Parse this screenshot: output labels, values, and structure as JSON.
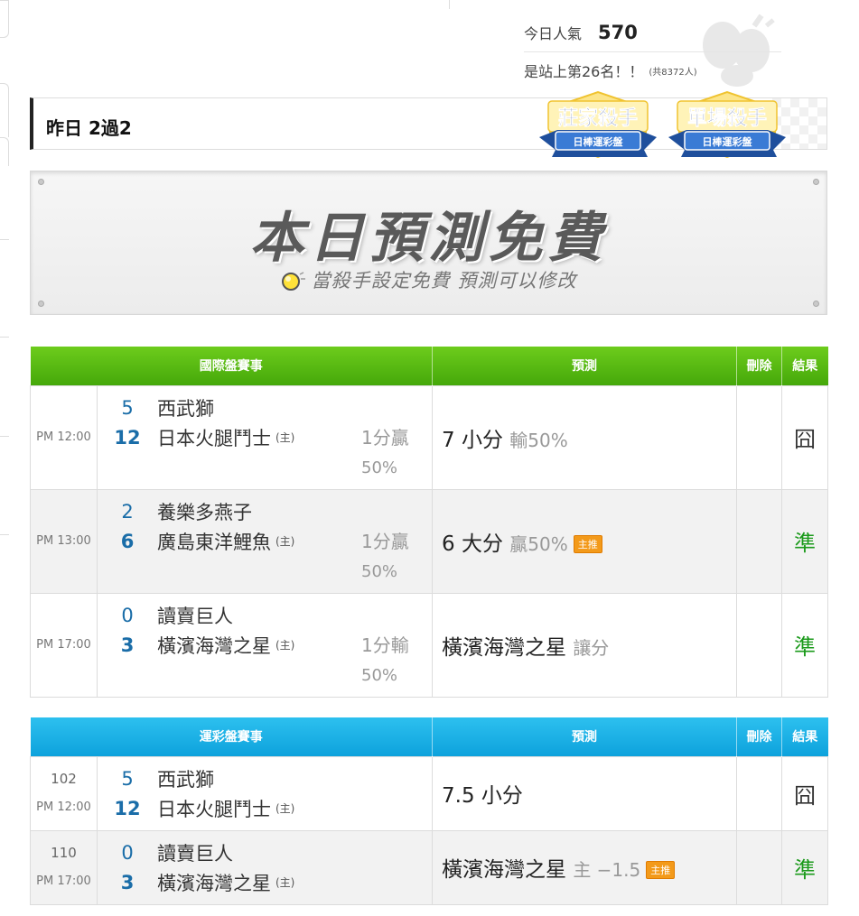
{
  "stats": {
    "today_label": "今日人氣",
    "today_value": "570",
    "rank_text": "是站上第26名！！",
    "rank_total": "(共8372人)"
  },
  "yesterday": {
    "text": "昨日 2過2"
  },
  "badges": [
    {
      "title": "莊家殺手",
      "sub": "日棒運彩盤"
    },
    {
      "title": "單場殺手",
      "sub": "日棒運彩盤"
    }
  ],
  "banner": {
    "title": "本日預測免費",
    "subtitle": "當殺手設定免費  預測可以修改"
  },
  "intl": {
    "headers": {
      "match": "國際盤賽事",
      "predict": "預測",
      "delete": "刪除",
      "result": "結果"
    },
    "rows": [
      {
        "time": "PM 12:00",
        "away_score": "5",
        "away": "西武獅",
        "home_score": "12",
        "home": "日本火腿鬥士",
        "host": "(主)",
        "spread": "1分贏",
        "pct": "50%",
        "pick": "7 小分",
        "pick_sub": "輸50%",
        "tag": "",
        "result": "囧"
      },
      {
        "time": "PM 13:00",
        "away_score": "2",
        "away": "養樂多燕子",
        "home_score": "6",
        "home": "廣島東洋鯉魚",
        "host": "(主)",
        "spread": "1分贏",
        "pct": "50%",
        "pick": "6 大分",
        "pick_sub": "贏50%",
        "tag": "主推",
        "result": "準"
      },
      {
        "time": "PM 17:00",
        "away_score": "0",
        "away": "讀賣巨人",
        "home_score": "3",
        "home": "橫濱海灣之星",
        "host": "(主)",
        "spread": "1分輸",
        "pct": "50%",
        "pick": "橫濱海灣之星",
        "pick_sub": "讓分",
        "tag": "",
        "result": "準"
      }
    ]
  },
  "lottery": {
    "headers": {
      "match": "運彩盤賽事",
      "predict": "預測",
      "delete": "刪除",
      "result": "結果"
    },
    "rows": [
      {
        "code": "102",
        "time": "PM 12:00",
        "away_score": "5",
        "away": "西武獅",
        "home_score": "12",
        "home": "日本火腿鬥士",
        "host": "(主)",
        "pick": "7.5 小分",
        "pick_sub": "",
        "tag": "",
        "result": "囧"
      },
      {
        "code": "110",
        "time": "PM 17:00",
        "away_score": "0",
        "away": "讀賣巨人",
        "home_score": "3",
        "home": "橫濱海灣之星",
        "host": "(主)",
        "pick": "橫濱海灣之星",
        "pick_sub": "主 −1.5",
        "tag": "主推",
        "result": "準"
      }
    ]
  },
  "colors": {
    "green_header": "#45a80a",
    "blue_header": "#0da2dc",
    "correct": "#1b9a1b",
    "score": "#1a6da8",
    "tag": "#f39a1a"
  }
}
